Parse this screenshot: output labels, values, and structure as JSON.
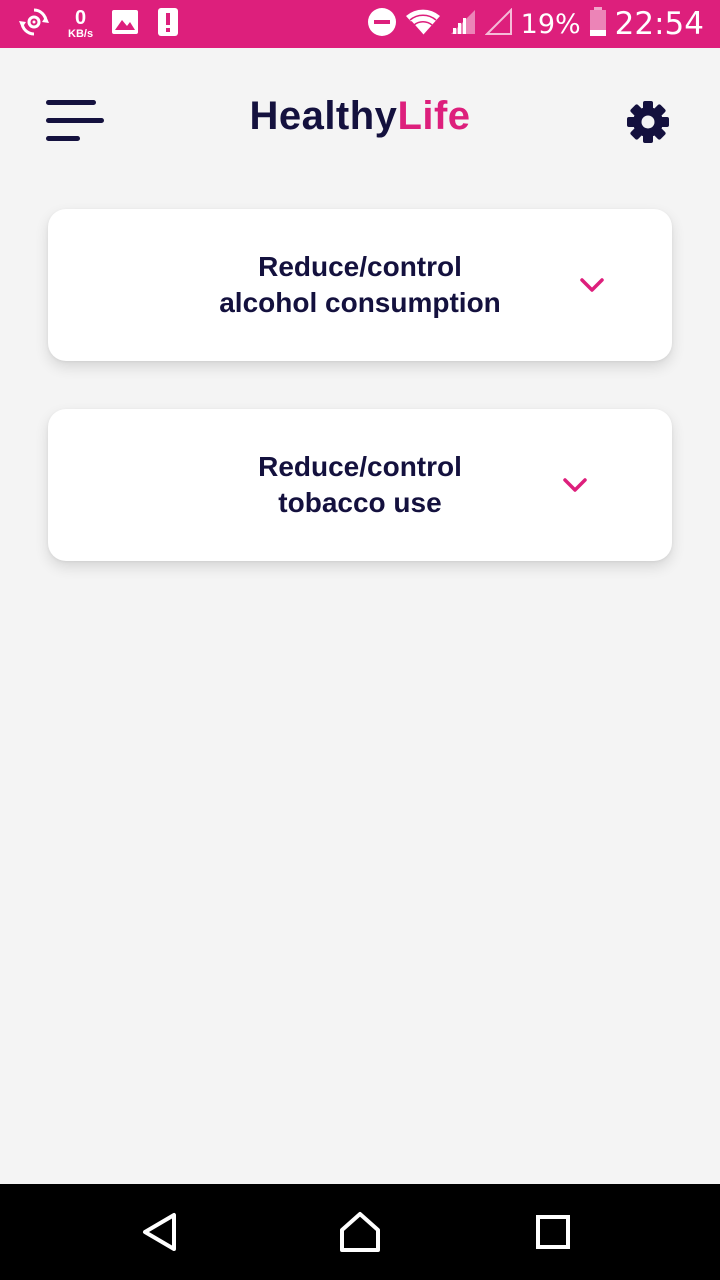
{
  "status_bar": {
    "data_rate_value": "0",
    "data_rate_unit": "KB/s",
    "battery_percent": "19%",
    "time": "22:54",
    "left_icons": [
      "sync-gear-icon",
      "image-icon",
      "alert-icon"
    ],
    "right_icons": [
      "do-not-disturb-icon",
      "wifi-icon",
      "signal-icon",
      "signal-empty-icon",
      "battery-icon"
    ]
  },
  "header": {
    "title_part1": "Healthy",
    "title_part2": "Life",
    "menu_icon": "menu-icon",
    "settings_icon": "gear-icon"
  },
  "cards": [
    {
      "line1": "Reduce/control",
      "line2": "alcohol consumption",
      "icon": "chevron-down-icon"
    },
    {
      "line1": "Reduce/control",
      "line2": "tobacco use",
      "icon": "chevron-down-icon"
    }
  ],
  "nav_bar": {
    "icons": [
      "back-icon",
      "home-icon",
      "recents-icon"
    ]
  },
  "colors": {
    "brand_pink": "#dd1f7c",
    "navy": "#14113e",
    "background": "#f4f4f4",
    "card": "#ffffff"
  }
}
